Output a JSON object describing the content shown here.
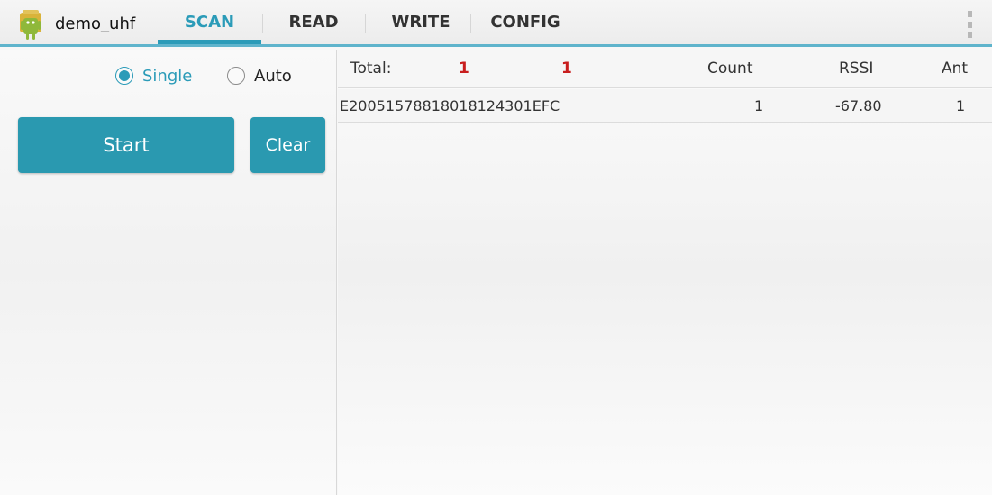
{
  "app": {
    "title": "demo_uhf",
    "icon": "android-icon"
  },
  "tabs": [
    {
      "label": "SCAN",
      "active": true
    },
    {
      "label": "READ",
      "active": false
    },
    {
      "label": "WRITE",
      "active": false
    },
    {
      "label": "CONFIG",
      "active": false
    }
  ],
  "overflow_menu": {
    "icon": "overflow-menu-icon"
  },
  "scan_mode": {
    "options": [
      {
        "label": "Single",
        "checked": true
      },
      {
        "label": "Auto",
        "checked": false
      }
    ]
  },
  "buttons": {
    "start_label": "Start",
    "clear_label": "Clear"
  },
  "table": {
    "total_label": "Total:",
    "total_count_1": "1",
    "total_count_2": "1",
    "columns": {
      "count": "Count",
      "rssi": "RSSI",
      "ant": "Ant"
    },
    "rows": [
      {
        "epc": "E20051578818018124301EFC",
        "count": "1",
        "rssi": "-67.80",
        "ant": "1"
      }
    ]
  },
  "colors": {
    "accent": "#2b9bb8",
    "button": "#2a99b0",
    "highlight": "#c81e1e"
  }
}
